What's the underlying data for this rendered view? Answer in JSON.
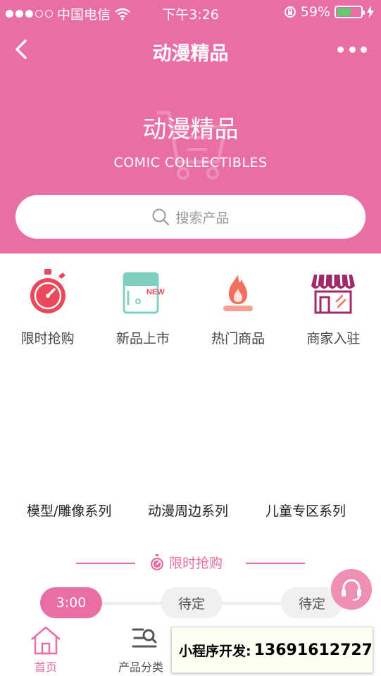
{
  "status_bar": {
    "carrier": "中国电信",
    "time": "下午3:26",
    "battery_text": "59%",
    "battery_level": 0.59
  },
  "navbar": {
    "title": "动漫精品"
  },
  "hero": {
    "title": "动漫精品",
    "subtitle": "COMIC COLLECTIBLES"
  },
  "search": {
    "placeholder": "搜索产品"
  },
  "quick_links": [
    {
      "label": "限时抢购",
      "icon": "stopwatch-icon"
    },
    {
      "label": "新品上市",
      "icon": "new-badge-icon",
      "badge": "NEW"
    },
    {
      "label": "热门商品",
      "icon": "flame-icon"
    },
    {
      "label": "商家入驻",
      "icon": "storefront-icon"
    }
  ],
  "categories": [
    "模型/雕像系列",
    "动漫周边系列",
    "儿童专区系列"
  ],
  "flash_sale": {
    "title": "限时抢购",
    "slots": [
      {
        "label": "3:00",
        "state": "active"
      },
      {
        "label": "待定",
        "state": "pending"
      },
      {
        "label": "待定",
        "state": "pending"
      }
    ]
  },
  "tabbar": {
    "tabs": [
      {
        "label": "首页",
        "icon": "home-icon",
        "active": true
      },
      {
        "label": "产品分类",
        "icon": "category-search-icon",
        "active": false
      }
    ]
  },
  "promo": {
    "label": "小程序开发:",
    "phone": "13691612727"
  },
  "colors": {
    "brand": "#e96ea5",
    "battery": "#59d16b",
    "icon_red": "#e9495a",
    "icon_teal": "#7fd0bf",
    "icon_purple": "#a0296a"
  }
}
